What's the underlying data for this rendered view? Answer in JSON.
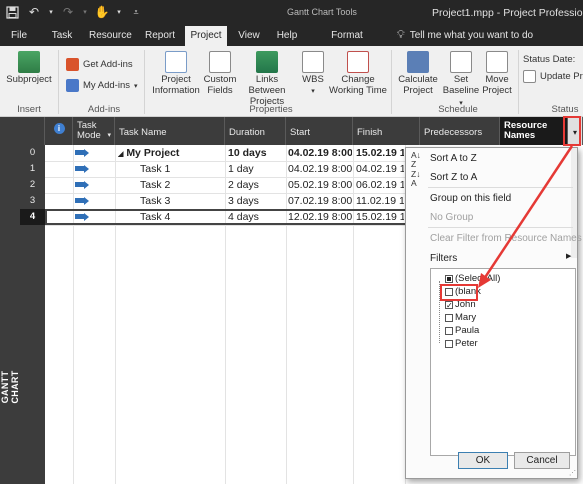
{
  "titlebar": {
    "tools_context": "Gantt Chart Tools",
    "window_title": "Project1.mpp - Project Professional"
  },
  "tabs": [
    "File",
    "Task",
    "Resource",
    "Report",
    "Project",
    "View",
    "Help",
    "Format"
  ],
  "active_tab": "Project",
  "tell_me": "Tell me what you want to do",
  "ribbon": {
    "subproject": "Subproject",
    "insert_group": "Insert",
    "get_addins": "Get Add-ins",
    "my_addins": "My Add-ins",
    "addins_group": "Add-ins",
    "project_information": [
      "Project",
      "Information"
    ],
    "custom_fields": [
      "Custom",
      "Fields"
    ],
    "links_between_projects": [
      "Links Between",
      "Projects"
    ],
    "wbs": "WBS",
    "change_working_time": [
      "Change",
      "Working Time"
    ],
    "properties_group": "Properties",
    "calculate_project": [
      "Calculate",
      "Project"
    ],
    "set_baseline": [
      "Set",
      "Baseline"
    ],
    "move_project": [
      "Move",
      "Project"
    ],
    "schedule_group": "Schedule",
    "status_date": "Status Date:",
    "update_project": "Update Pr",
    "status_group": "Status"
  },
  "view_label": "GANTT CHART",
  "columns": {
    "info": "i",
    "task_mode": [
      "Task",
      "Mode"
    ],
    "task_name": "Task Name",
    "duration": "Duration",
    "start": "Start",
    "finish": "Finish",
    "predecessors": "Predecessors",
    "resource_names": [
      "Resource",
      "Names"
    ]
  },
  "rows": [
    {
      "id": "0",
      "name": "My Project",
      "duration": "10 days",
      "start": "04.02.19 8:00",
      "finish": "15.02.19 17",
      "summary": true,
      "collapse_glyph": "◢"
    },
    {
      "id": "1",
      "name": "Task 1",
      "duration": "1 day",
      "start": "04.02.19 8:00",
      "finish": "04.02.19 17"
    },
    {
      "id": "2",
      "name": "Task 2",
      "duration": "2 days",
      "start": "05.02.19 8:00",
      "finish": "06.02.19 17"
    },
    {
      "id": "3",
      "name": "Task 3",
      "duration": "3 days",
      "start": "07.02.19 8:00",
      "finish": "11.02.19 17"
    },
    {
      "id": "4",
      "name": "Task 4",
      "duration": "4 days",
      "start": "12.02.19 8:00",
      "finish": "15.02.19 17"
    }
  ],
  "selected_row": "4",
  "filter_menu": {
    "sort_az": "Sort A to Z",
    "sort_za": "Sort Z to A",
    "group_on_field": "Group on this field",
    "no_group": "No Group",
    "clear_filter": "Clear Filter from Resource Names",
    "filters": "Filters",
    "list": [
      {
        "label": "(Select All)",
        "state": "partial"
      },
      {
        "label": "(blank",
        "state": "unchecked"
      },
      {
        "label": "John",
        "state": "checked"
      },
      {
        "label": "Mary",
        "state": "unchecked"
      },
      {
        "label": "Paula",
        "state": "unchecked"
      },
      {
        "label": "Peter",
        "state": "unchecked"
      }
    ],
    "ok": "OK",
    "cancel": "Cancel"
  },
  "colors": {
    "annotation_red": "#e53935",
    "dark_chrome": "#262626",
    "header_dark": "#3c3c3c",
    "task_mode_blue": "#2f6fb7"
  }
}
